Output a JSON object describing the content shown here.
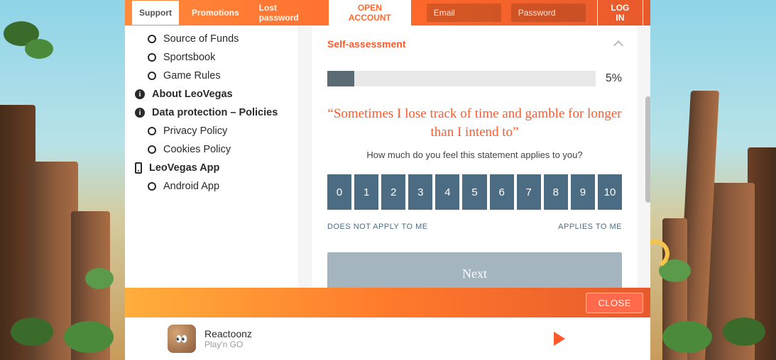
{
  "topbar": {
    "nav": [
      "Support",
      "Promotions",
      "Lost password"
    ],
    "open_account": "OPEN ACCOUNT",
    "email_placeholder": "Email",
    "password_placeholder": "Password",
    "login": "LOG IN"
  },
  "sidebar": {
    "items": [
      {
        "icon": "circle",
        "label": "Source of Funds",
        "indent": true
      },
      {
        "icon": "circle",
        "label": "Sportsbook",
        "indent": true
      },
      {
        "icon": "circle",
        "label": "Game Rules",
        "indent": true
      },
      {
        "icon": "info",
        "label": "About LeoVegas",
        "heading": true
      },
      {
        "icon": "info",
        "label": "Data protection – Policies",
        "heading": true
      },
      {
        "icon": "circle",
        "label": "Privacy Policy",
        "indent": true
      },
      {
        "icon": "circle",
        "label": "Cookies Policy",
        "indent": true
      },
      {
        "icon": "phone",
        "label": "LeoVegas App",
        "heading": true
      },
      {
        "icon": "circle",
        "label": "Android App",
        "indent": true
      }
    ]
  },
  "assessment": {
    "title": "Self-assessment",
    "progress_pct": "5%",
    "progress_value": 10,
    "question": "“Sometimes I lose track of time and gamble for longer than I intend to”",
    "subquestion": "How much do you feel this statement applies to you?",
    "scale": [
      "0",
      "1",
      "2",
      "3",
      "4",
      "5",
      "6",
      "7",
      "8",
      "9",
      "10"
    ],
    "scale_low": "DOES NOT APPLY TO ME",
    "scale_high": "APPLIES TO ME",
    "next": "Next"
  },
  "close_bar": {
    "close": "CLOSE"
  },
  "footer": {
    "game_name": "Reactoonz",
    "provider": "Play'n GO"
  }
}
